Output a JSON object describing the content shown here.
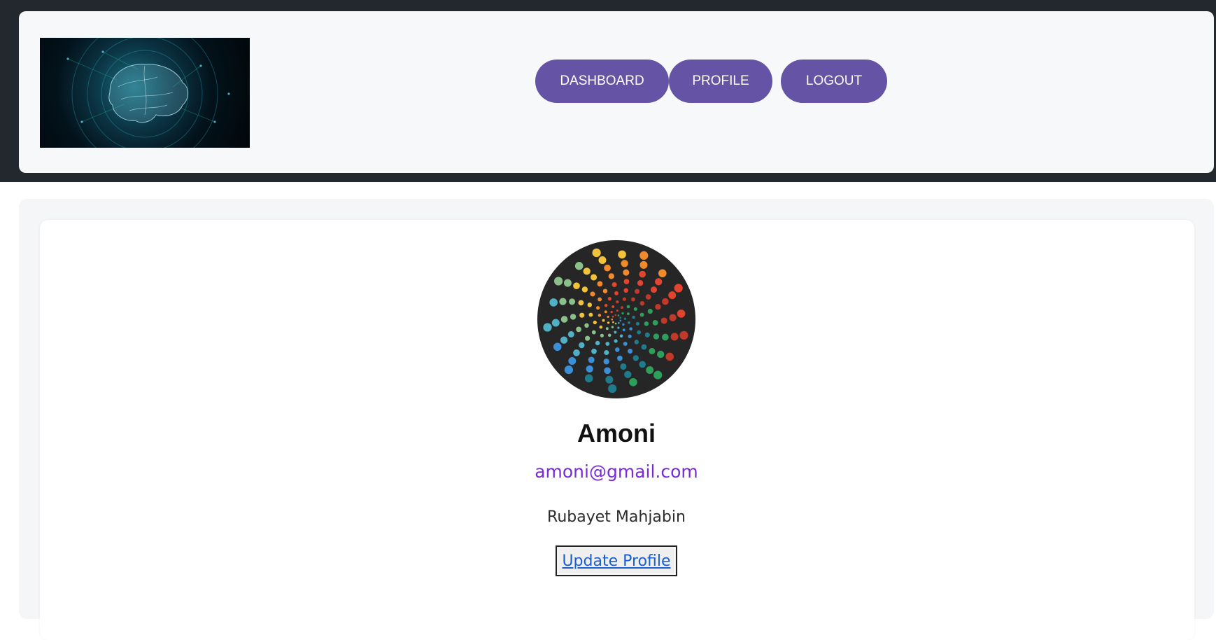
{
  "nav": {
    "dashboard_label": "DASHBOARD",
    "profile_label": "PROFILE",
    "logout_label": "LOGOUT",
    "button_color": "#6553a5"
  },
  "header": {
    "logo_icon": "brain-network-icon",
    "background_color": "#23272e"
  },
  "profile": {
    "avatar_icon": "spiral-dots-avatar",
    "username": "Amoni",
    "email": "amoni@gmail.com",
    "full_name": "Rubayet Mahjabin",
    "update_label": "Update Profile",
    "email_color": "#7a2bd8",
    "link_color": "#1a5fd1"
  }
}
